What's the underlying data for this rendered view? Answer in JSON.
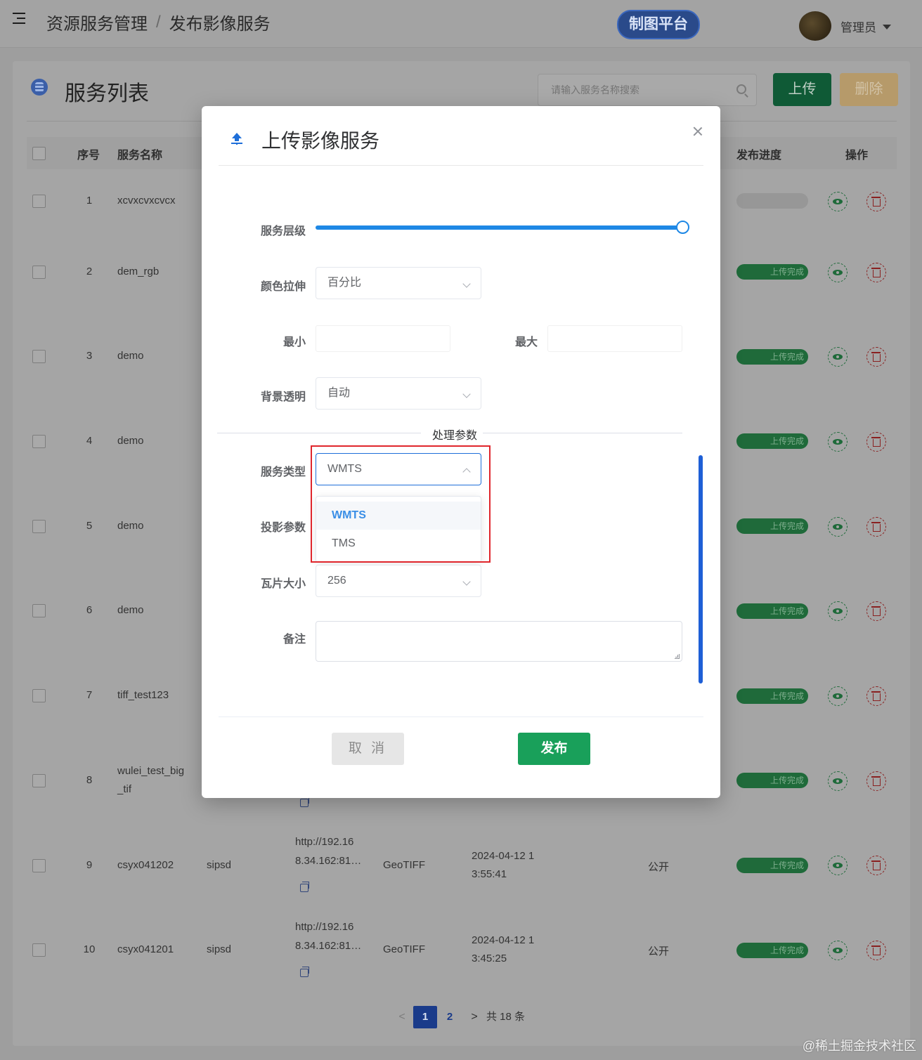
{
  "header": {
    "breadcrumb": [
      "资源服务管理",
      "发布影像服务"
    ],
    "separator": "/",
    "platform_button": "制图平台",
    "user": "管理员"
  },
  "page": {
    "title": "服务列表",
    "search_placeholder": "请输入服务名称搜索",
    "upload_label": "上传",
    "delete_label": "删除"
  },
  "table": {
    "headers": {
      "seq": "序号",
      "name": "服务名称",
      "progress": "发布进度",
      "ops": "操作"
    },
    "rows": [
      {
        "seq": "1",
        "name": "xcvxcvxcvcx",
        "status": ""
      },
      {
        "seq": "2",
        "name": "dem_rgb",
        "status": "上传完成"
      },
      {
        "seq": "3",
        "name": "demo",
        "status": "上传完成"
      },
      {
        "seq": "4",
        "name": "demo",
        "status": "上传完成"
      },
      {
        "seq": "5",
        "name": "demo",
        "status": "上传完成"
      },
      {
        "seq": "6",
        "name": "demo",
        "status": "上传完成"
      },
      {
        "seq": "7",
        "name": "tiff_test123",
        "status": "上传完成"
      },
      {
        "seq": "8",
        "name_line1": "wulei_test_big",
        "name_line2": "_tif",
        "status": "上传完成"
      },
      {
        "seq": "9",
        "name": "csyx041202",
        "type": "sipsd",
        "url_line1": "http://192.16",
        "url_line2": "8.34.162:81…",
        "format": "GeoTIFF",
        "time_line1": "2024-04-12 1",
        "time_line2": "3:55:41",
        "access": "公开",
        "status": "上传完成"
      },
      {
        "seq": "10",
        "name": "csyx041201",
        "type": "sipsd",
        "url_line1": "http://192.16",
        "url_line2": "8.34.162:81…",
        "format": "GeoTIFF",
        "time_line1": "2024-04-12 1",
        "time_line2": "3:45:25",
        "access": "公开",
        "status": "上传完成"
      }
    ]
  },
  "pagination": {
    "prev": "<",
    "pages": [
      "1",
      "2"
    ],
    "next": ">",
    "total": "共 18 条",
    "current_page": 1
  },
  "modal": {
    "title": "上传影像服务",
    "fields": {
      "level_label": "服务层级",
      "level_value": 1.0,
      "stretch_label": "颜色拉伸",
      "stretch_value": "百分比",
      "min_label": "最小",
      "max_label": "最大",
      "bg_label": "背景透明",
      "bg_value": "自动",
      "section_title": "处理参数",
      "service_type_label": "服务类型",
      "service_type_value": "WMTS",
      "service_type_options": [
        "WMTS",
        "TMS"
      ],
      "projection_label": "投影参数",
      "tile_size_label": "瓦片大小",
      "tile_size_value": "256",
      "remark_label": "备注"
    },
    "cancel_label": "取 消",
    "publish_label": "发布"
  },
  "watermark": "@稀土掘金技术社区",
  "colors": {
    "primary": "#1e88e5",
    "success": "#19a05a",
    "highlight": "#e0262c",
    "dropdown_selected": "#3a8ee6"
  }
}
